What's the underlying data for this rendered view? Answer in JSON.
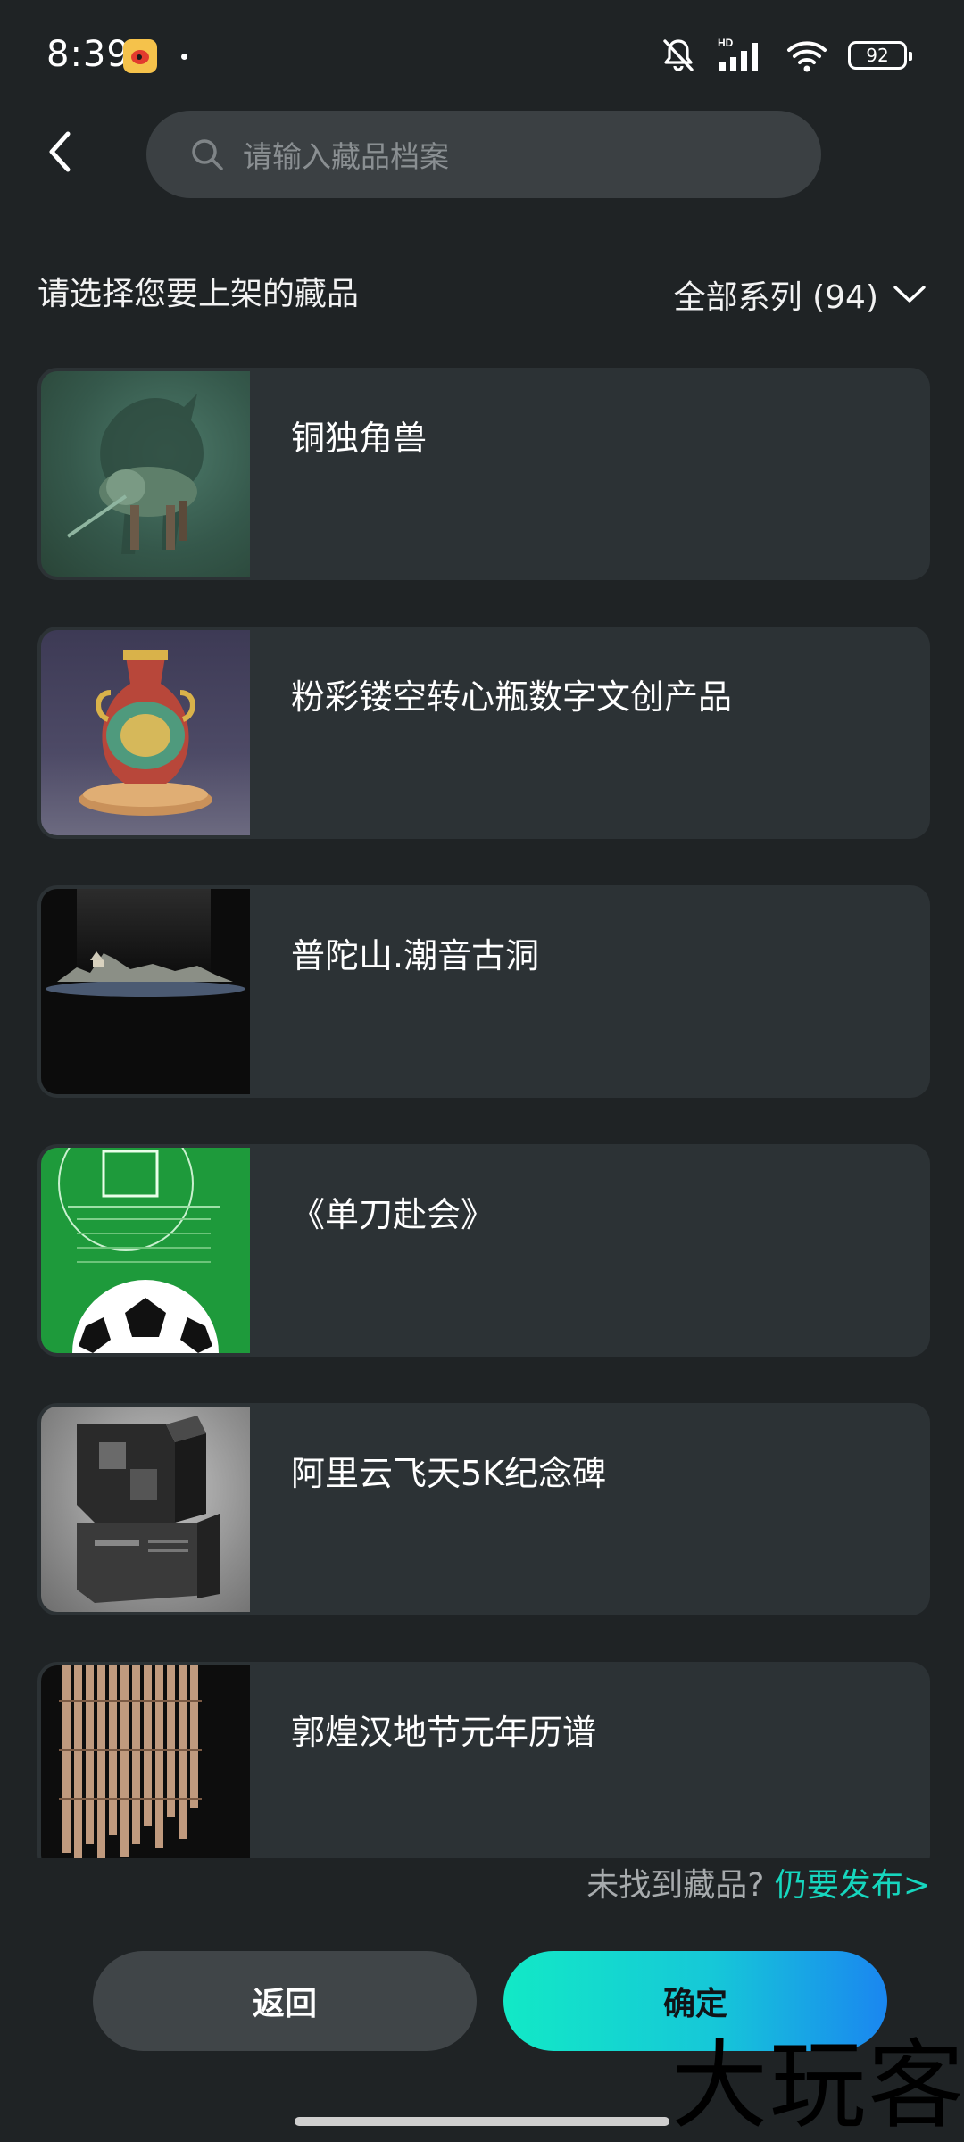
{
  "status_bar": {
    "time": "8:39",
    "battery": "92",
    "network_label": "HD"
  },
  "search": {
    "placeholder": "请输入藏品档案"
  },
  "header": {
    "title": "请选择您要上架的藏品",
    "filter_label": "全部系列 (94)"
  },
  "items": [
    {
      "title": "铜独角兽",
      "thumb_icon": "unicorn-thumbnail"
    },
    {
      "title": "粉彩镂空转心瓶数字文创产品",
      "thumb_icon": "vase-thumbnail"
    },
    {
      "title": "普陀山.潮音古洞",
      "thumb_icon": "mountain-thumbnail"
    },
    {
      "title": "《单刀赴会》",
      "thumb_icon": "football-poster-thumbnail"
    },
    {
      "title": "阿里云飞天5K纪念碑",
      "thumb_icon": "monument-thumbnail"
    },
    {
      "title": "郭煌汉地节元年历谱",
      "thumb_icon": "bamboo-slips-thumbnail"
    }
  ],
  "footer": {
    "not_found_text": "未找到藏品?",
    "publish_link": "仍要发布>",
    "back_button": "返回",
    "confirm_button": "确定"
  },
  "watermark": "大玩客",
  "colors": {
    "background": "#1f2325",
    "card": "#2c3235",
    "accent": "#16d6be",
    "confirm_gradient_start": "#12e9c6",
    "confirm_gradient_end": "#1a86f0"
  }
}
